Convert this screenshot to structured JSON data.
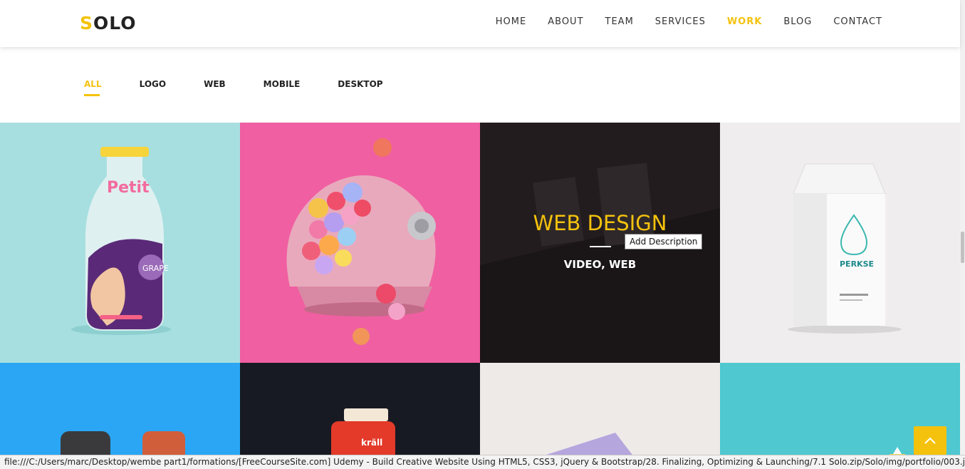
{
  "header": {
    "logo_first": "S",
    "logo_rest": "OLO",
    "nav": [
      "HOME",
      "ABOUT",
      "TEAM",
      "SERVICES",
      "WORK",
      "BLOG",
      "CONTACT"
    ],
    "active_nav": "WORK"
  },
  "filters": {
    "items": [
      "ALL",
      "LOGO",
      "WEB",
      "MOBILE",
      "DESKTOP"
    ],
    "active": "ALL"
  },
  "portfolio": {
    "hover_title": "WEB DESIGN",
    "hover_categories": "VIDEO, WEB",
    "tooltip": "Add Description",
    "tile_images": [
      "bottle-image",
      "astronaut-helmet-image",
      "web-design-image",
      "milk-carton-image",
      "chairs-image",
      "mug-image",
      "paper-image",
      "bottles-image"
    ]
  },
  "status": {
    "url": "file:///C:/Users/marc/Desktop/wembe part1/formations/[FreeCourseSite.com] Udemy - Build Creative Website Using HTML5, CSS3, jQuery & Bootstrap/28. Finalizing,  Optimizing & Launching/7.1 Solo.zip/Solo/img/portfolio/003.jpg"
  },
  "colors": {
    "accent": "#f4c20d"
  }
}
